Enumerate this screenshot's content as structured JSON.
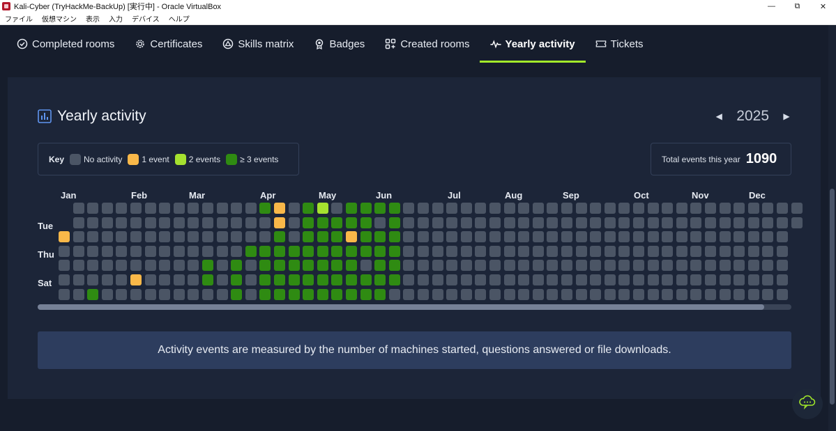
{
  "window": {
    "title": "Kali-Cyber (TryHackMe-BackUp) [実行中] - Oracle VirtualBox",
    "controls": [
      "—",
      "⧉",
      "✕"
    ],
    "menu": [
      "ファイル",
      "仮想マシン",
      "表示",
      "入力",
      "デバイス",
      "ヘルプ"
    ]
  },
  "tabs": [
    {
      "label": "Completed rooms",
      "icon": "check-circle-icon",
      "active": false
    },
    {
      "label": "Certificates",
      "icon": "certificate-icon",
      "active": false
    },
    {
      "label": "Skills matrix",
      "icon": "skills-matrix-icon",
      "active": false
    },
    {
      "label": "Badges",
      "icon": "badge-icon",
      "active": false
    },
    {
      "label": "Created rooms",
      "icon": "created-rooms-icon",
      "active": false
    },
    {
      "label": "Yearly activity",
      "icon": "activity-pulse-icon",
      "active": true
    },
    {
      "label": "Tickets",
      "icon": "ticket-icon",
      "active": false
    }
  ],
  "activity": {
    "title": "Yearly activity",
    "year": "2025",
    "key": {
      "label": "Key",
      "items": [
        {
          "text": "No activity",
          "color": "#4b5565"
        },
        {
          "text": "1 event",
          "color": "#f9b849"
        },
        {
          "text": "2 events",
          "color": "#a5e12f"
        },
        {
          "text": "≥ 3 events",
          "color": "#2f8b12"
        }
      ]
    },
    "total": {
      "label": "Total events this year",
      "value": "1090"
    },
    "months": [
      "Jan",
      "Feb",
      "Mar",
      "Apr",
      "May",
      "Jun",
      "Jul",
      "Aug",
      "Sep",
      "Oct",
      "Nov",
      "Dec"
    ],
    "day_labels": [
      "Tue",
      "Thu",
      "Sat"
    ],
    "colors": {
      "0": "#4b5565",
      "1": "#f9b849",
      "2": "#a5e12f",
      "3": "#2f8b12"
    },
    "grid": {
      "weeks": 52,
      "first_week_start_day": 2,
      "last_week_end_day": 1,
      "cells": [
        [
          14,
          0,
          3
        ],
        [
          15,
          0,
          1
        ],
        [
          17,
          0,
          3
        ],
        [
          18,
          0,
          2
        ],
        [
          20,
          0,
          3
        ],
        [
          21,
          0,
          3
        ],
        [
          22,
          0,
          3
        ],
        [
          23,
          0,
          3
        ],
        [
          15,
          1,
          1
        ],
        [
          17,
          1,
          3
        ],
        [
          18,
          1,
          3
        ],
        [
          19,
          1,
          3
        ],
        [
          20,
          1,
          3
        ],
        [
          21,
          1,
          3
        ],
        [
          23,
          1,
          3
        ],
        [
          0,
          2,
          1
        ],
        [
          15,
          2,
          3
        ],
        [
          17,
          2,
          3
        ],
        [
          18,
          2,
          3
        ],
        [
          19,
          2,
          3
        ],
        [
          20,
          2,
          1
        ],
        [
          21,
          2,
          3
        ],
        [
          22,
          2,
          3
        ],
        [
          23,
          2,
          3
        ],
        [
          13,
          3,
          3
        ],
        [
          14,
          3,
          3
        ],
        [
          15,
          3,
          3
        ],
        [
          16,
          3,
          3
        ],
        [
          17,
          3,
          3
        ],
        [
          18,
          3,
          3
        ],
        [
          19,
          3,
          3
        ],
        [
          20,
          3,
          3
        ],
        [
          21,
          3,
          3
        ],
        [
          22,
          3,
          3
        ],
        [
          23,
          3,
          3
        ],
        [
          10,
          4,
          3
        ],
        [
          12,
          4,
          3
        ],
        [
          14,
          4,
          3
        ],
        [
          15,
          4,
          3
        ],
        [
          16,
          4,
          3
        ],
        [
          17,
          4,
          3
        ],
        [
          18,
          4,
          3
        ],
        [
          19,
          4,
          3
        ],
        [
          20,
          4,
          3
        ],
        [
          22,
          4,
          3
        ],
        [
          23,
          4,
          3
        ],
        [
          5,
          5,
          1
        ],
        [
          10,
          5,
          3
        ],
        [
          12,
          5,
          3
        ],
        [
          14,
          5,
          3
        ],
        [
          15,
          5,
          3
        ],
        [
          16,
          5,
          3
        ],
        [
          17,
          5,
          3
        ],
        [
          18,
          5,
          3
        ],
        [
          19,
          5,
          3
        ],
        [
          20,
          5,
          3
        ],
        [
          21,
          5,
          3
        ],
        [
          22,
          5,
          3
        ],
        [
          23,
          5,
          3
        ],
        [
          2,
          6,
          3
        ],
        [
          12,
          6,
          3
        ],
        [
          14,
          6,
          3
        ],
        [
          15,
          6,
          3
        ],
        [
          16,
          6,
          3
        ],
        [
          17,
          6,
          3
        ],
        [
          18,
          6,
          3
        ],
        [
          19,
          6,
          3
        ],
        [
          20,
          6,
          3
        ],
        [
          21,
          6,
          3
        ],
        [
          22,
          6,
          3
        ]
      ]
    },
    "info": "Activity events are measured by the number of machines started, questions answered or file downloads."
  },
  "chat": {
    "icon": "chat-cloud-icon"
  }
}
